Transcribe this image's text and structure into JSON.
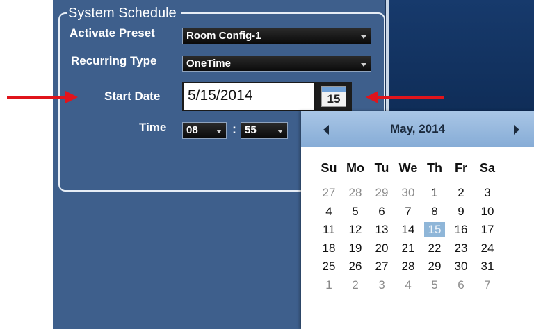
{
  "schedule": {
    "legend": "System Schedule",
    "activate_preset_label": "Activate Preset",
    "activate_preset_value": "Room Config-1",
    "recurring_type_label": "Recurring Type",
    "recurring_type_value": "OneTime",
    "start_date_label": "Start Date",
    "start_date_value": "5/15/2014",
    "calendar_button_day": "15",
    "time_label": "Time",
    "hour_value": "08",
    "time_separator": ":",
    "minute_value": "55"
  },
  "calendar": {
    "month_title": "May, 2014",
    "prev_icon": "triangle-left-icon",
    "next_icon": "triangle-right-icon",
    "weekdays": [
      "Su",
      "Mo",
      "Tu",
      "We",
      "Th",
      "Fr",
      "Sa"
    ],
    "weeks": [
      [
        "27",
        "28",
        "29",
        "30",
        "1",
        "2",
        "3"
      ],
      [
        "4",
        "5",
        "6",
        "7",
        "8",
        "9",
        "10"
      ],
      [
        "11",
        "12",
        "13",
        "14",
        "15",
        "16",
        "17"
      ],
      [
        "18",
        "19",
        "20",
        "21",
        "22",
        "23",
        "24"
      ],
      [
        "25",
        "26",
        "27",
        "28",
        "29",
        "30",
        "31"
      ],
      [
        "1",
        "2",
        "3",
        "4",
        "5",
        "6",
        "7"
      ]
    ],
    "selected_day": "15"
  },
  "colors": {
    "panel_blue": "#3e5f8c",
    "annotation_red": "#e0141b",
    "calendar_header": "#a9c6e6",
    "selected_day_bg": "#8fb6d8"
  }
}
